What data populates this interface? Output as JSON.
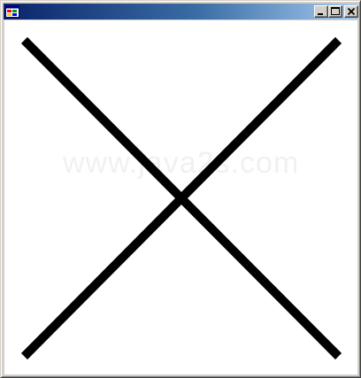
{
  "window": {
    "title": "",
    "app_icon": "windows-forms-app-icon",
    "controls": {
      "minimize_icon": "minimize-icon",
      "maximize_icon": "maximize-icon",
      "close_icon": "close-icon"
    }
  },
  "canvas": {
    "watermark": "www.java2s.com",
    "line_color": "#000000",
    "background_color": "#ffffff"
  },
  "colors": {
    "titlebar_start": "#0a246a",
    "titlebar_end": "#a6caf0",
    "chrome": "#d4d0c8"
  }
}
